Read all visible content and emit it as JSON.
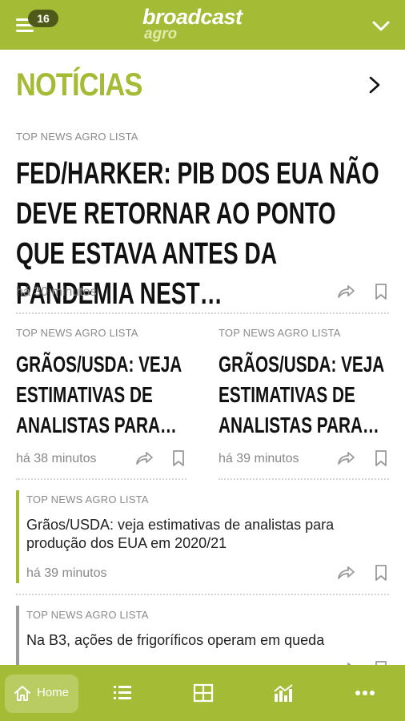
{
  "header": {
    "badge_count": "16",
    "logo_main": "broadcast",
    "logo_sub": "agro"
  },
  "section": {
    "title": "NOTÍCIAS"
  },
  "featured": {
    "tag": "TOP NEWS AGRO LISTA",
    "title": "FED/HARKER: PIB DOS EUA NÃO DEVE RETORNAR AO PONTO QUE ESTAVA ANTES DA PANDEMIA NEST…",
    "time": "há 30 minutos"
  },
  "columns": [
    {
      "tag": "TOP NEWS AGRO LISTA",
      "title": "GRÃOS/USDA: VEJA ESTIMATIVAS DE ANALISTAS PARA…",
      "time": "há 38 minutos"
    },
    {
      "tag": "TOP NEWS AGRO LISTA",
      "title": "GRÃOS/USDA: VEJA ESTIMATIVAS DE ANALISTAS PARA…",
      "time": "há 39 minutos"
    }
  ],
  "list": [
    {
      "tag": "TOP NEWS AGRO LISTA",
      "headline": "Grãos/USDA: veja estimativas de analistas para produção dos EUA em 2020/21",
      "time": "há 39 minutos",
      "accent": "#a3bb35"
    },
    {
      "tag": "TOP NEWS AGRO LISTA",
      "headline": "Na B3, ações de frigoríficos operam em queda",
      "accent": "#9a9a9a"
    }
  ],
  "bottom_nav": {
    "home_label": "Home",
    "items": [
      "home-icon",
      "list-icon",
      "grid-icon",
      "chart-icon",
      "more-icon"
    ]
  },
  "colors": {
    "brand": "#a3bb35",
    "badge": "#4f5a1a"
  }
}
